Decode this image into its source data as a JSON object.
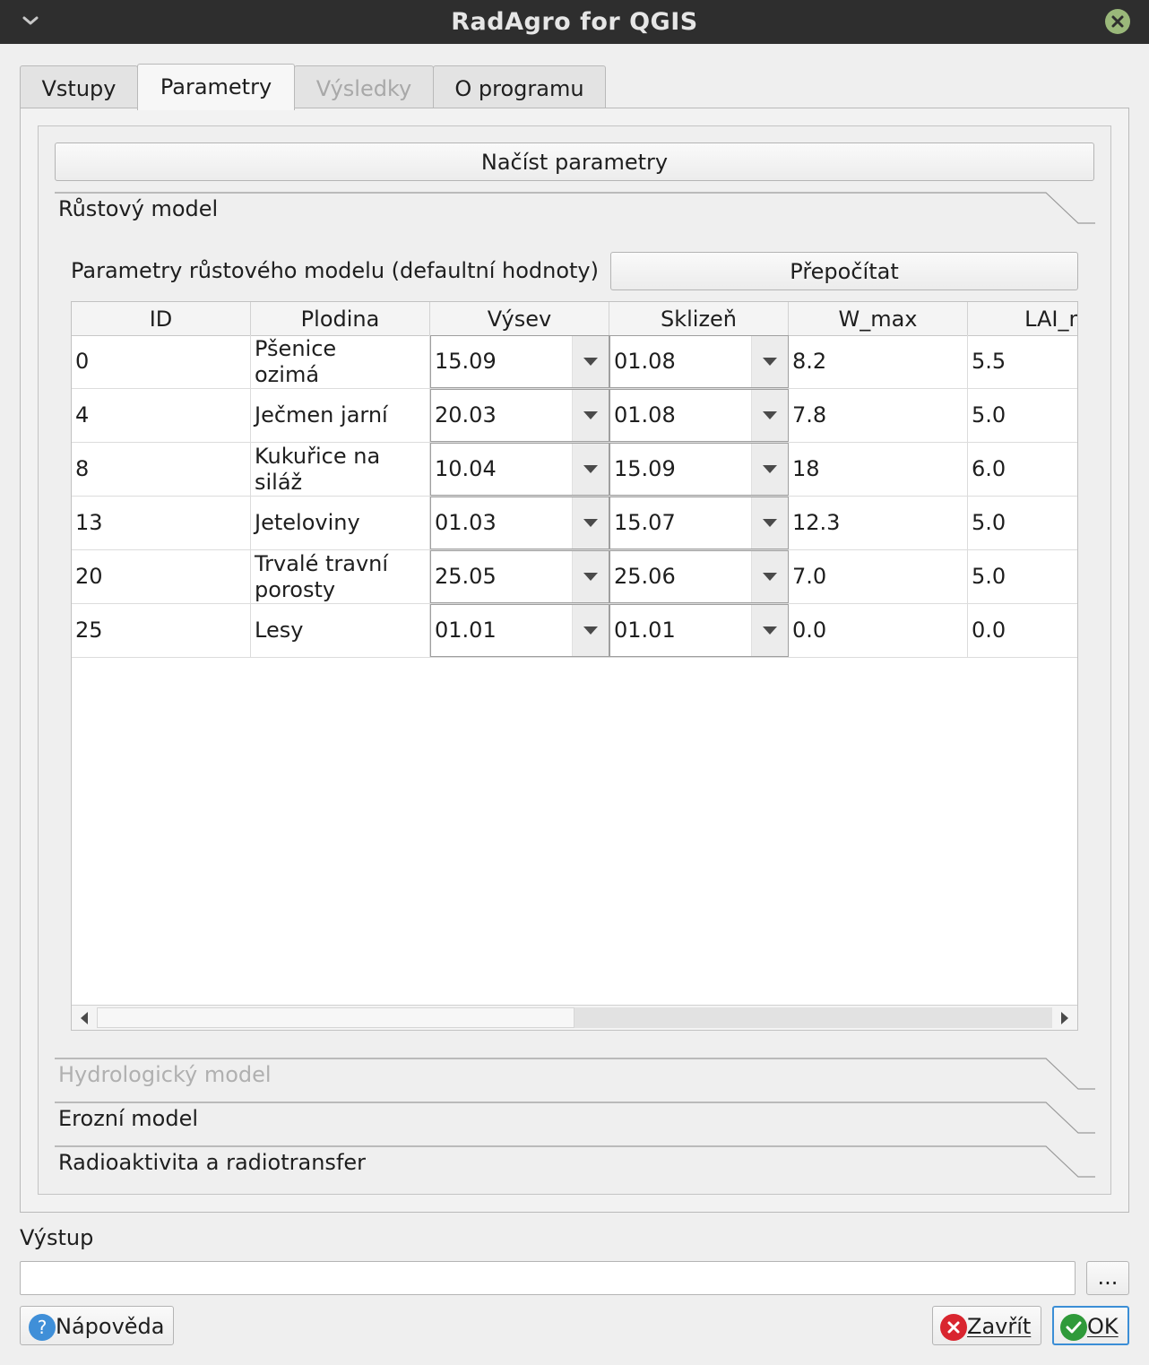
{
  "window": {
    "title": "RadAgro for QGIS"
  },
  "tabs": [
    {
      "label": "Vstupy",
      "state": "normal"
    },
    {
      "label": "Parametry",
      "state": "active"
    },
    {
      "label": "Výsledky",
      "state": "disabled"
    },
    {
      "label": "O programu",
      "state": "normal"
    }
  ],
  "load_button": "Načíst parametry",
  "sections": {
    "growth": "Růstový model",
    "hydro": "Hydrologický model",
    "erosion": "Erozní model",
    "radio": "Radioaktivita a radiotransfer"
  },
  "growth": {
    "params_label": "Parametry růstového modelu (defaultní hodnoty)",
    "recalc_button": "Přepočítat"
  },
  "table": {
    "columns": [
      "ID",
      "Plodina",
      "Výsev",
      "Sklizeň",
      "W_max",
      "LAI_m"
    ],
    "rows": [
      {
        "id": "0",
        "crop": "Pšenice ozimá",
        "sow": "15.09",
        "harvest": "01.08",
        "wmax": "8.2",
        "lai": "5.5"
      },
      {
        "id": "4",
        "crop": "Ječmen jarní",
        "sow": "20.03",
        "harvest": "01.08",
        "wmax": "7.8",
        "lai": "5.0"
      },
      {
        "id": "8",
        "crop": "Kukuřice na siláž",
        "sow": "10.04",
        "harvest": "15.09",
        "wmax": "18",
        "lai": "6.0"
      },
      {
        "id": "13",
        "crop": "Jeteloviny",
        "sow": "01.03",
        "harvest": "15.07",
        "wmax": "12.3",
        "lai": "5.0"
      },
      {
        "id": "20",
        "crop": "Trvalé travní porosty",
        "sow": "25.05",
        "harvest": "25.06",
        "wmax": "7.0",
        "lai": "5.0"
      },
      {
        "id": "25",
        "crop": "Lesy",
        "sow": "01.01",
        "harvest": "01.01",
        "wmax": "0.0",
        "lai": "0.0"
      }
    ]
  },
  "output": {
    "label": "Výstup",
    "value": "",
    "browse_button": "..."
  },
  "footer": {
    "help_button": "Nápověda",
    "close_button": "Zavřít",
    "ok_button": "OK"
  },
  "icons": {
    "help": "help-icon",
    "close": "close-icon",
    "ok": "check-icon"
  },
  "colors": {
    "titlebar": "#2e2e2e",
    "help_icon": "#3f8fd8",
    "close_icon": "#d9252f",
    "ok_icon": "#2f9a3a",
    "ok_border": "#3b8ed6"
  }
}
